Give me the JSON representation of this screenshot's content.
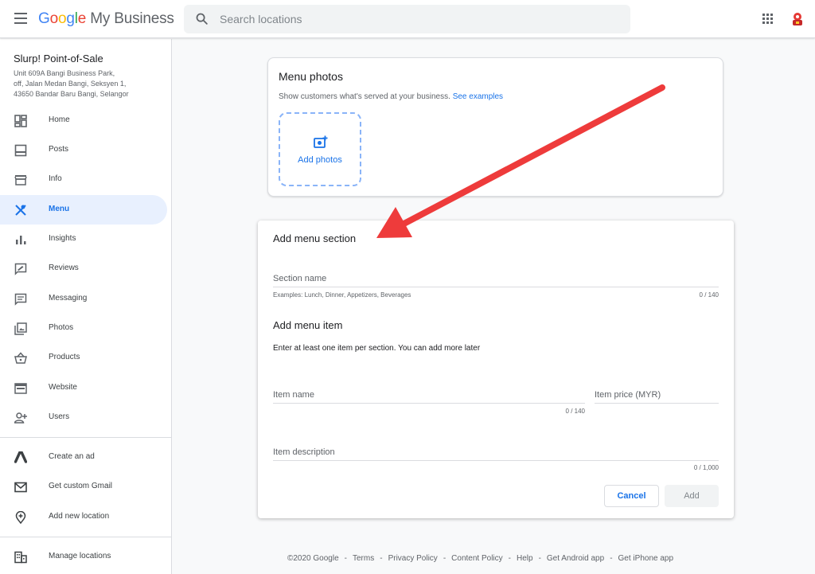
{
  "header": {
    "logo_google": [
      "G",
      "o",
      "o",
      "g",
      "l",
      "e"
    ],
    "logo_product": "My Business",
    "search_placeholder": "Search locations"
  },
  "business": {
    "name": "Slurp! Point-of-Sale",
    "address_line1": "Unit 609A Bangi Business Park,",
    "address_line2": "off, Jalan Medan Bangi, Seksyen 1,",
    "address_line3": "43650 Bandar Baru Bangi, Selangor"
  },
  "sidebar": {
    "items": [
      {
        "label": "Home",
        "icon": "dashboard-icon"
      },
      {
        "label": "Posts",
        "icon": "posts-icon"
      },
      {
        "label": "Info",
        "icon": "storefront-icon"
      },
      {
        "label": "Menu",
        "icon": "restaurant-icon",
        "active": true
      },
      {
        "label": "Insights",
        "icon": "bar-chart-icon"
      },
      {
        "label": "Reviews",
        "icon": "reviews-icon"
      },
      {
        "label": "Messaging",
        "icon": "message-icon"
      },
      {
        "label": "Photos",
        "icon": "photo-library-icon"
      },
      {
        "label": "Products",
        "icon": "basket-icon"
      },
      {
        "label": "Website",
        "icon": "web-icon"
      },
      {
        "label": "Users",
        "icon": "person-add-icon"
      }
    ],
    "extras": [
      {
        "label": "Create an ad",
        "icon": "google-ads-icon"
      },
      {
        "label": "Get custom Gmail",
        "icon": "gmail-icon"
      },
      {
        "label": "Add new location",
        "icon": "add-location-icon"
      }
    ],
    "manage": {
      "label": "Manage locations",
      "icon": "domain-icon"
    }
  },
  "menu_photos": {
    "title": "Menu photos",
    "description": "Show customers what's served at your business.",
    "link": "See examples",
    "add_photos": "Add photos"
  },
  "add_section": {
    "title": "Add menu section",
    "section_name_placeholder": "Section name",
    "section_hint": "Examples: Lunch, Dinner, Appetizers, Beverages",
    "section_counter": "0 / 140",
    "item_title": "Add menu item",
    "item_subtitle": "Enter at least one item per section. You can add more later",
    "item_name_placeholder": "Item name",
    "item_name_counter": "0 / 140",
    "item_price_placeholder": "Item price (MYR)",
    "item_desc_placeholder": "Item description",
    "item_desc_counter": "0 / 1,000",
    "cancel": "Cancel",
    "add": "Add"
  },
  "footer": {
    "copyright": "©2020 Google",
    "links": [
      "Terms",
      "Privacy Policy",
      "Content Policy",
      "Help",
      "Get Android app",
      "Get iPhone app"
    ]
  },
  "colors": {
    "accent": "#1a73e8",
    "active_bg": "#e8f0fe",
    "annotation_arrow": "#ee3b3b"
  }
}
